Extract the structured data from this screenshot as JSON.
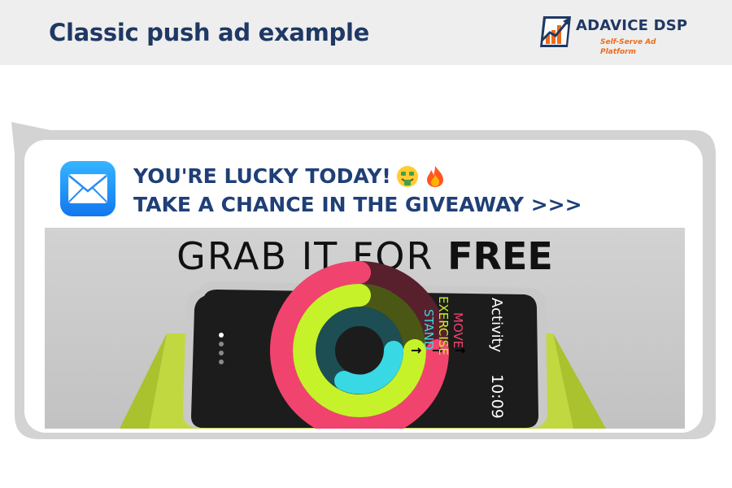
{
  "header": {
    "title": "Classic push ad example",
    "logo": {
      "name": "ADAVICE DSP",
      "tagline": "Self-Serve Ad Platform"
    }
  },
  "notification": {
    "app_icon": "mail-icon",
    "headline_line1": "YOU'RE LUCKY TODAY!",
    "headline_line2": "TAKE A CHANCE IN THE GIVEAWAY >>>",
    "emojis": [
      "money-mouth-face-icon",
      "fire-icon"
    ]
  },
  "banner": {
    "title_light": "GRAB IT FOR",
    "title_bold": "FREE",
    "watch": {
      "app_title": "Activity",
      "time": "10:09",
      "ring_labels": [
        "MOVE",
        "EXERCISE",
        "STAND"
      ]
    }
  },
  "colors": {
    "title_navy": "#1f3864",
    "headline_blue": "#1f3f77",
    "logo_orange": "#ee6b1a",
    "band_green": "#c2d840",
    "ring_move": "#f0446e",
    "ring_exercise": "#c6f22a",
    "ring_stand": "#38d9e4"
  }
}
